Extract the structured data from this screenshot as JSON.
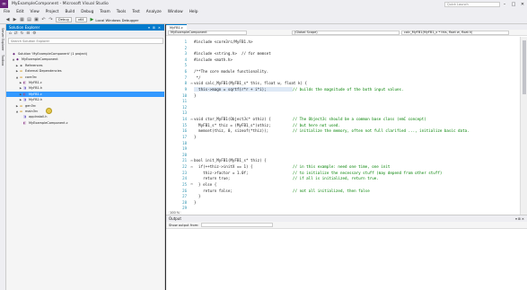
{
  "window": {
    "title": "MyExampleComponent - Microsoft Visual Studio",
    "quick_launch_placeholder": "Quick Launch",
    "logo_icon": "vs-logo-icon"
  },
  "menu": [
    "File",
    "Edit",
    "View",
    "Project",
    "Build",
    "Debug",
    "Team",
    "Tools",
    "Test",
    "Analyze",
    "Window",
    "Help"
  ],
  "toolbar": {
    "configuration": "Debug",
    "platform": "x64",
    "debugger_label": "Local Windows Debugger"
  },
  "side_tabs": [
    "Server Explorer",
    "Toolbox"
  ],
  "solution_explorer": {
    "title": "Solution Explorer",
    "search_placeholder": "Search Solution Explorer",
    "items": [
      {
        "label": "Solution 'MyExampleComponent' (1 project)",
        "icon": "sln",
        "arrow": ""
      },
      {
        "label": "MyExampleComponent",
        "icon": "proj",
        "arrow": "▲"
      },
      {
        "label": "References",
        "icon": "ref",
        "arrow": "▶"
      },
      {
        "label": "External Dependencies",
        "icon": "folder",
        "arrow": "▶"
      },
      {
        "label": "core3rc",
        "icon": "folder",
        "arrow": "▲"
      },
      {
        "label": "MyFB1.c",
        "icon": "cpp",
        "arrow": "▶"
      },
      {
        "label": "MyFB1.h",
        "icon": "h",
        "arrow": "▶"
      },
      {
        "label": "MyFB1.c",
        "icon": "cpp",
        "arrow": "▶"
      },
      {
        "label": "MyFB2.h",
        "icon": "h",
        "arrow": "▶"
      },
      {
        "label": "gen3rc",
        "icon": "folder",
        "arrow": "▶"
      },
      {
        "label": "main3rc",
        "icon": "folder",
        "arrow": "▲"
      },
      {
        "label": "appInstall.h",
        "icon": "h",
        "arrow": ""
      },
      {
        "label": "MyExampleComponent.c",
        "icon": "cpp",
        "arrow": ""
      }
    ]
  },
  "editor": {
    "tab_label": "MyFB1.c",
    "nav_project": "MyExampleComponent",
    "nav_scope": "(Global Scope)",
    "nav_function": "calc_MyFB1(MyFB1_x * this, float w, float k)",
    "zoom": "100 %",
    "lines": [
      {
        "n": "1",
        "fold": "",
        "text": "#include <core3rc/MyFB1.h>",
        "comment": ""
      },
      {
        "n": "2",
        "fold": "",
        "text": "",
        "comment": ""
      },
      {
        "n": "3",
        "fold": "",
        "text": "#include <string.h>  // for memset",
        "comment": ""
      },
      {
        "n": "4",
        "fold": "",
        "text": "#include <math.h>",
        "comment": ""
      },
      {
        "n": "5",
        "fold": "",
        "text": "",
        "comment": ""
      },
      {
        "n": "6",
        "fold": "",
        "text": "/**The core module functionality.",
        "comment": ""
      },
      {
        "n": "7",
        "fold": "",
        "text": " */",
        "comment": ""
      },
      {
        "n": "8",
        "fold": "⊟",
        "text": "void calc_MyFB1(MyFB1_s* this, float w, float k) {",
        "comment": ""
      },
      {
        "n": "9",
        "fold": "",
        "text": "  this->magn = sqrtf(r*r + i*i);",
        "comment": "// builds the magnitude of the both input values."
      },
      {
        "n": "10",
        "fold": "",
        "text": "}",
        "comment": ""
      },
      {
        "n": "11",
        "fold": "",
        "text": "",
        "comment": ""
      },
      {
        "n": "12",
        "fold": "",
        "text": "",
        "comment": ""
      },
      {
        "n": "13",
        "fold": "",
        "text": "",
        "comment": ""
      },
      {
        "n": "14",
        "fold": "⊟",
        "text": "void ctor_MyFB1(ObjectJc* othiz) {",
        "comment": "// The ObjectJc should be a common base class (emC concept)"
      },
      {
        "n": "15",
        "fold": "",
        "text": "  MyFB1_s* thiz = (MyFB1_s*)othiz;",
        "comment": "// but here not used."
      },
      {
        "n": "16",
        "fold": "",
        "text": "  memset(thiz, 0, sizeof(*thiz));",
        "comment": "// initialize the memory, often not full clarified ..., initialize basic data."
      },
      {
        "n": "17",
        "fold": "",
        "text": "}",
        "comment": ""
      },
      {
        "n": "18",
        "fold": "",
        "text": "",
        "comment": ""
      },
      {
        "n": "19",
        "fold": "",
        "text": "",
        "comment": ""
      },
      {
        "n": "20",
        "fold": "",
        "text": "",
        "comment": ""
      },
      {
        "n": "21",
        "fold": "⊟",
        "text": "bool init_MyFB1(MyFB1_s* thiz) {",
        "comment": ""
      },
      {
        "n": "22",
        "fold": "⊟",
        "text": "  if(++thiz->initX == 1) {",
        "comment": "// in this example: need one time, one init"
      },
      {
        "n": "23",
        "fold": "",
        "text": "    thiz->factor = 1.0f;",
        "comment": "// to initialize the necessary stuff (may depend from other stuff)"
      },
      {
        "n": "24",
        "fold": "",
        "text": "    return true;",
        "comment": "// if all is initialized, return true."
      },
      {
        "n": "25",
        "fold": "⊟",
        "text": "  } else {",
        "comment": ""
      },
      {
        "n": "26",
        "fold": "",
        "text": "    return false;",
        "comment": "// not all initialized, then false"
      },
      {
        "n": "27",
        "fold": "",
        "text": "  }",
        "comment": ""
      },
      {
        "n": "28",
        "fold": "",
        "text": "}",
        "comment": ""
      },
      {
        "n": "29",
        "fold": "",
        "text": "",
        "comment": ""
      }
    ]
  },
  "output": {
    "title": "Output",
    "show_from_label": "Show output from:"
  }
}
